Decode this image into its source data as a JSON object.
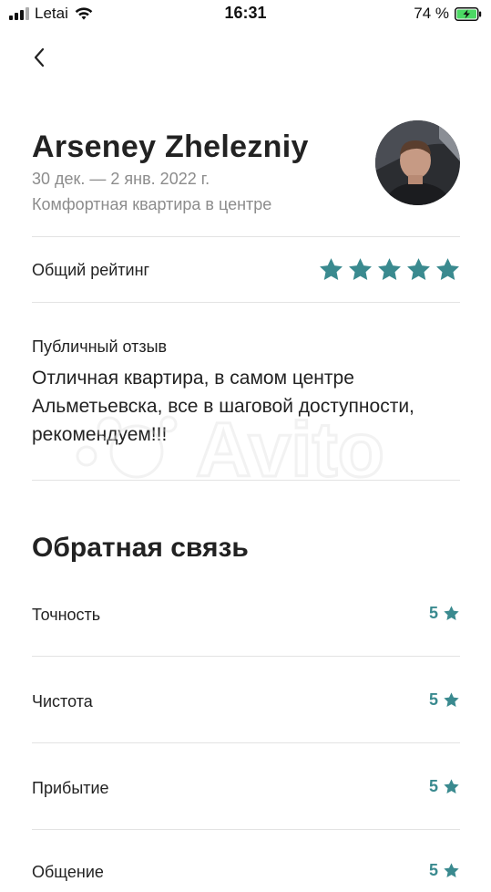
{
  "status_bar": {
    "carrier": "Letai",
    "time": "16:31",
    "battery": "74 %"
  },
  "review": {
    "name": "Arseney Zhelezniy",
    "dates": "30 дек. — 2 янв. 2022 г.",
    "listing": "Комфортная квартира в центре",
    "overall_label": "Общий рейтинг",
    "overall_stars": 5,
    "public_label": "Публичный отзыв",
    "public_text": "Отличная квартира, в самом центре Альметьевска, все в шаговой доступности, рекомендуем!!!"
  },
  "feedback": {
    "title": "Обратная связь",
    "items": [
      {
        "label": "Точность",
        "score": "5"
      },
      {
        "label": "Чистота",
        "score": "5"
      },
      {
        "label": "Прибытие",
        "score": "5"
      },
      {
        "label": "Общение",
        "score": "5"
      }
    ]
  },
  "colors": {
    "accent": "#3a8a8f",
    "secondary_text": "#8c8c8c",
    "divider": "#e3e3e3"
  },
  "icons": {
    "back": "chevron-left-icon",
    "star": "star-icon"
  }
}
